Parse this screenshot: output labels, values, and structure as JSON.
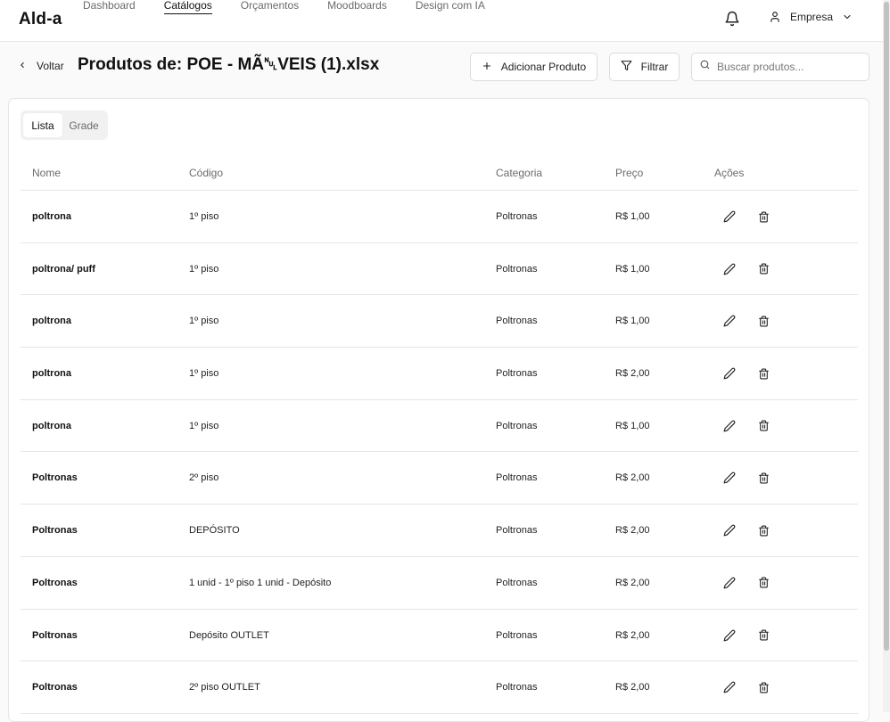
{
  "app": {
    "logo": "Ald-a"
  },
  "nav": {
    "items": [
      {
        "label": "Dashboard",
        "active": false
      },
      {
        "label": "Catálogos",
        "active": true
      },
      {
        "label": "Orçamentos",
        "active": false
      },
      {
        "label": "Moodboards",
        "active": false
      },
      {
        "label": "Design com IA",
        "active": false
      }
    ]
  },
  "user": {
    "name": "Empresa",
    "icons": [
      "bell-icon",
      "user-icon",
      "chevron-down-icon"
    ]
  },
  "header": {
    "back_label": "Voltar",
    "title": "Produtos de: POE - MÃ␀VEIS (1).xlsx",
    "add_label": "Adicionar Produto",
    "filter_label": "Filtrar",
    "search_placeholder": "Buscar produtos..."
  },
  "view_toggle": {
    "list_label": "Lista",
    "grid_label": "Grade",
    "selected": "Lista"
  },
  "table": {
    "columns": [
      "Nome",
      "Código",
      "Categoria",
      "Preço",
      "Ações"
    ],
    "rows": [
      {
        "name": "poltrona",
        "code": "1º piso",
        "category": "Poltronas",
        "price": "R$ 1,00"
      },
      {
        "name": "poltrona/ puff",
        "code": "1º piso",
        "category": "Poltronas",
        "price": "R$ 1,00"
      },
      {
        "name": "poltrona",
        "code": "1º piso",
        "category": "Poltronas",
        "price": "R$ 1,00"
      },
      {
        "name": "poltrona",
        "code": "1º piso",
        "category": "Poltronas",
        "price": "R$ 2,00"
      },
      {
        "name": "poltrona",
        "code": "1º piso",
        "category": "Poltronas",
        "price": "R$ 1,00"
      },
      {
        "name": "Poltronas",
        "code": "2º piso",
        "category": "Poltronas",
        "price": "R$ 2,00"
      },
      {
        "name": "Poltronas",
        "code": "DEPÓSITO",
        "category": "Poltronas",
        "price": "R$ 2,00"
      },
      {
        "name": "Poltronas",
        "code": "1 unid - 1º piso 1 unid - Depósito",
        "category": "Poltronas",
        "price": "R$ 2,00"
      },
      {
        "name": "Poltronas",
        "code": "Depósito OUTLET",
        "category": "Poltronas",
        "price": "R$ 2,00"
      },
      {
        "name": "Poltronas",
        "code": "2º piso OUTLET",
        "category": "Poltronas",
        "price": "R$ 2,00"
      }
    ]
  }
}
